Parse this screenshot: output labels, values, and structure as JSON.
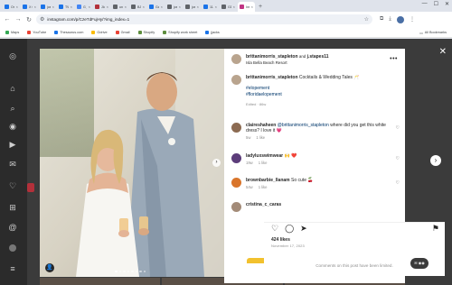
{
  "browser": {
    "tabs": [
      {
        "label": "Onvuri",
        "color": "#1a73e8",
        "active": false
      },
      {
        "label": "X Goo",
        "color": "#1a73e8",
        "active": false
      },
      {
        "label": "joshus",
        "color": "#1a73e8",
        "active": false
      },
      {
        "label": "TWKY",
        "color": "#1a73e8",
        "active": false
      },
      {
        "label": "G joshu",
        "color": "#4285f4",
        "active": false
      },
      {
        "label": "Jlodbur",
        "color": "#b3303a",
        "active": false
      },
      {
        "label": "untitlo",
        "color": "#5f6368",
        "active": false
      },
      {
        "label": "BJBSM",
        "color": "#5f6368",
        "active": false
      },
      {
        "label": "GaFn",
        "color": "#1a73e8",
        "active": false
      },
      {
        "label": "joshus",
        "color": "#5f6368",
        "active": false
      },
      {
        "label": "joshus",
        "color": "#5f6368",
        "active": false
      },
      {
        "label": "11Ahru",
        "color": "#1a73e8",
        "active": false
      },
      {
        "label": "GDPR",
        "color": "#5f6368",
        "active": false
      },
      {
        "label": "Ins",
        "color": "#c13584",
        "active": true
      }
    ],
    "url": "instagram.com/p/CzeTdFujHy/?img_index=1",
    "bookmarks": [
      "Maps",
      "YouTube",
      "Thesaurus.com",
      "Gdrive",
      "Gmail",
      "Shopify",
      "Shopify work sheet",
      "jjacks"
    ],
    "all_bookmarks": "All Bookmarks"
  },
  "post": {
    "author": "brittanimorris_stapleton",
    "with_text": "and",
    "coauthor": "j.stapes11",
    "location": "Isla Bella Beach Resort",
    "caption_author": "brittanimorris_stapleton",
    "caption_text": "Cocktails & Wedding Tales 🥂",
    "hashtags": [
      "#elopement",
      "#floridaelopement"
    ],
    "edited": "Edited · 86w",
    "likes": "424 likes",
    "date": "November 17, 2023",
    "comments_limited": "Comments on this post have been limited."
  },
  "comments": [
    {
      "user": "claireshaheen",
      "mention": "@brittanimorris_stapleton",
      "text": "where did you get this white dress? I love it 💗",
      "time": "5w",
      "like_label": "1 like",
      "avatar_color": "#8c6b52"
    },
    {
      "user": "ladyluxswimwear",
      "mention": "",
      "text": "🙌 ❤️",
      "time": "19w",
      "like_label": "1 like",
      "avatar_color": "#5c3d7a"
    },
    {
      "user": "brownbarbie_llanam",
      "mention": "",
      "text": "So cute 🍒",
      "time": "54w",
      "like_label": "1 like",
      "avatar_color": "#d9752b"
    },
    {
      "user": "cristina_c_caras",
      "mention": "",
      "text": "",
      "time": "",
      "like_label": "",
      "avatar_color": "#a38b78"
    }
  ],
  "colors": {
    "link": "#00376b",
    "meta": "#8e8e8e",
    "overlay": "#3b3b3b"
  }
}
